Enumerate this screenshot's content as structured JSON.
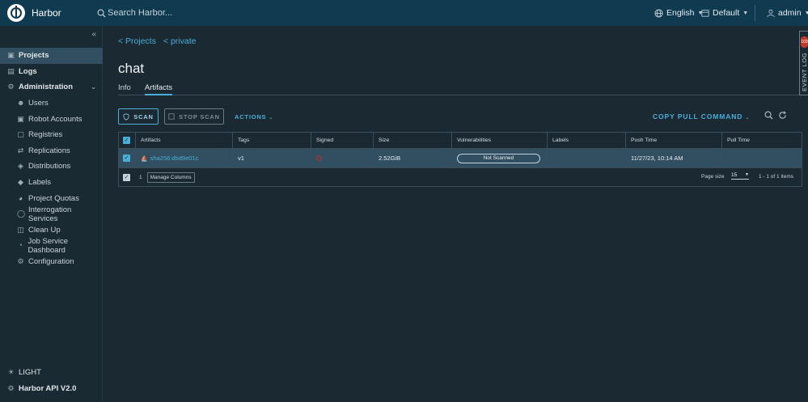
{
  "header": {
    "brand": "Harbor",
    "search_placeholder": "Search Harbor...",
    "language": "English",
    "scope": "Default",
    "user": "admin"
  },
  "sidebar": {
    "items": [
      {
        "label": "Projects",
        "icon": "projects-icon"
      },
      {
        "label": "Logs",
        "icon": "logs-icon"
      },
      {
        "label": "Administration",
        "icon": "administration-icon"
      },
      {
        "label": "Users",
        "icon": "users-icon"
      },
      {
        "label": "Robot Accounts",
        "icon": "robot-icon"
      },
      {
        "label": "Registries",
        "icon": "registries-icon"
      },
      {
        "label": "Replications",
        "icon": "replications-icon"
      },
      {
        "label": "Distributions",
        "icon": "distributions-icon"
      },
      {
        "label": "Labels",
        "icon": "labels-icon"
      },
      {
        "label": "Project Quotas",
        "icon": "quotas-icon"
      },
      {
        "label": "Interrogation Services",
        "icon": "interrogation-icon"
      },
      {
        "label": "Clean Up",
        "icon": "cleanup-icon"
      },
      {
        "label": "Job Service Dashboard",
        "icon": "dashboard-icon"
      },
      {
        "label": "Configuration",
        "icon": "configuration-icon"
      }
    ],
    "theme_toggle": "LIGHT",
    "api_link": "Harbor API V2.0"
  },
  "main": {
    "breadcrumb": [
      "< Projects",
      "< private"
    ],
    "title": "chat",
    "tabs": [
      "Info",
      "Artifacts"
    ],
    "active_tab": "Artifacts",
    "scan_label": "SCAN",
    "stop_scan_label": "STOP SCAN",
    "actions_label": "ACTIONS",
    "copy_pull_label": "COPY PULL COMMAND",
    "columns": [
      "Artifacts",
      "Tags",
      "Signed",
      "Size",
      "Vulnerabilities",
      "Labels",
      "Push Time",
      "Pull Time"
    ],
    "rows": [
      {
        "digest": "sha256:dbd9e01c",
        "tags": "v1",
        "size": "2.52GiB",
        "vulnerabilities": "Not Scanned",
        "labels": "",
        "push_time": "11/27/23, 10:14 AM",
        "pull_time": ""
      }
    ],
    "selected_count": "1",
    "manage_columns": "Manage Columns",
    "page_size_label": "Page size",
    "page_size_value": "15",
    "page_info": "1 - 1 of 1 items"
  },
  "event_log": {
    "label": "EVENT LOG",
    "count": "103"
  },
  "colors": {
    "header_bg": "#0f3a50",
    "accent": "#4aaed9",
    "body_bg": "#1b2a32",
    "active_row": "#324f61"
  }
}
